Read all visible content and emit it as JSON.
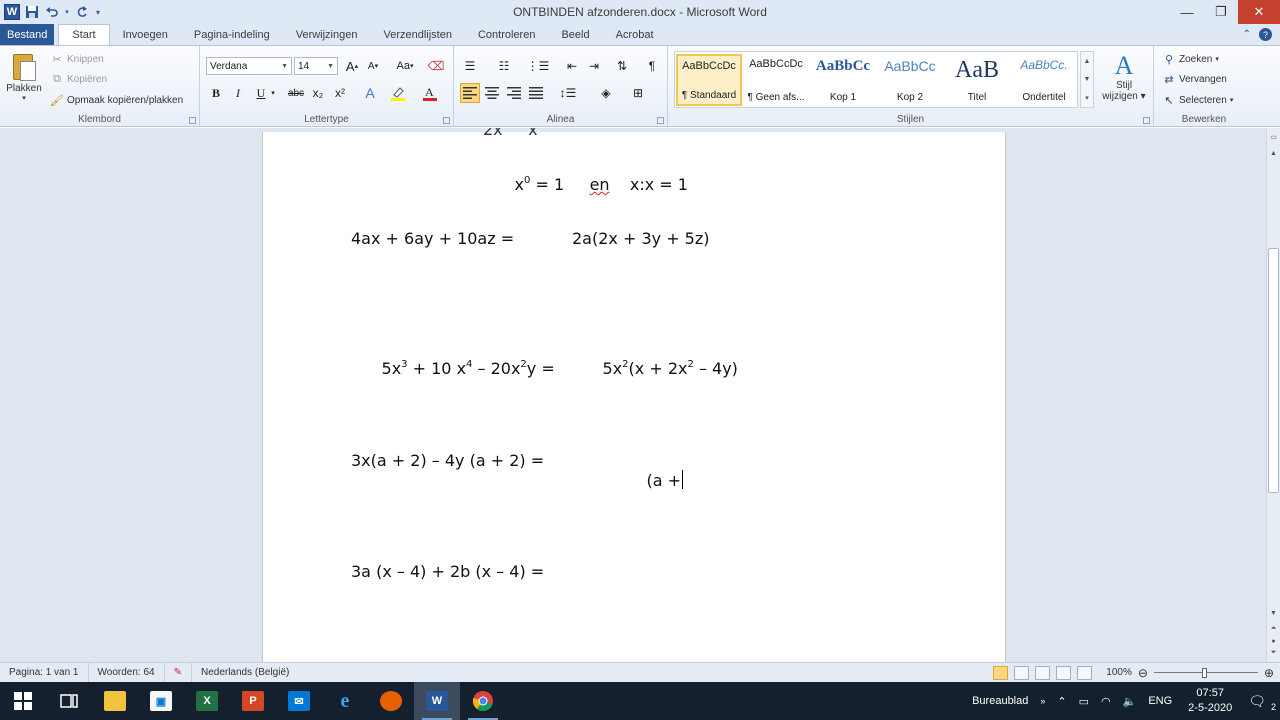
{
  "window": {
    "title": "ONTBINDEN afzonderen.docx - Microsoft Word",
    "app_logo": "W",
    "controls": [
      "minimize-icon",
      "restore-icon",
      "close-icon"
    ]
  },
  "qat": {
    "save": "save-icon",
    "undo": "undo-icon",
    "redo": "redo-icon"
  },
  "tabs": [
    "Bestand",
    "Start",
    "Invoegen",
    "Pagina-indeling",
    "Verwijzingen",
    "Verzendlijsten",
    "Controleren",
    "Beeld",
    "Acrobat"
  ],
  "active_tab": "Start",
  "ribbon": {
    "clipboard": {
      "label": "Klembord",
      "paste": "Plakken",
      "cut": "Knippen",
      "copy": "Kopiëren",
      "format_painter": "Opmaak kopiëren/plakken"
    },
    "font": {
      "label": "Lettertype",
      "font_name": "Verdana",
      "font_size": "14",
      "bold": "B",
      "italic": "I",
      "underline": "U",
      "strike": "abc",
      "subscript": "x₂",
      "superscript": "x²",
      "grow": "A",
      "shrink": "A",
      "case": "Aa"
    },
    "paragraph": {
      "label": "Alinea",
      "pilcrow": "¶"
    },
    "styles": {
      "label": "Stijlen",
      "items": [
        {
          "preview": "AaBbCcDc",
          "name": "¶ Standaard"
        },
        {
          "preview": "AaBbCcDc",
          "name": "¶ Geen afs..."
        },
        {
          "preview": "AaBbCc",
          "name": "Kop 1"
        },
        {
          "preview": "AaBbCc",
          "name": "Kop 2"
        },
        {
          "preview": "AaB",
          "name": "Titel"
        },
        {
          "preview": "AaBbCc.",
          "name": "Ondertitel"
        }
      ],
      "change_style_1": "Stijl",
      "change_style_2": "wijzigen"
    },
    "editing": {
      "label": "Bewerken",
      "find": "Zoeken",
      "replace": "Vervangen",
      "select": "Selecteren"
    }
  },
  "document": {
    "line0_a": "x",
    "line0_sup": "0",
    "line0_b": " = 1",
    "line0_en": "en",
    "line0_c": "x:x = 1",
    "eq1_left": "4ax + 6ay + 10az =",
    "eq1_right": "2a(2x + 3y + 5z)",
    "eq2_l1": "5x",
    "eq2_l1s": "3",
    "eq2_l2": " + 10 x",
    "eq2_l2s": "4",
    "eq2_l3": " – 20x",
    "eq2_l3s": "2",
    "eq2_l4": "y =",
    "eq2_r1": "5x",
    "eq2_r1s": "2",
    "eq2_r2": "(x + 2x",
    "eq2_r2s": "2",
    "eq2_r3": " – 4y)",
    "eq3_left": "3x(a + 2) – 4y (a + 2) =",
    "eq3_right": "(a +",
    "eq4_left": "3a (x – 4) + 2b (x – 4) ="
  },
  "statusbar": {
    "page": "Pagina: 1 van 1",
    "words": "Woorden: 64",
    "language": "Nederlands (België)",
    "zoom": "100%",
    "zoom_level_percent": 100
  },
  "taskbar": {
    "apps": [
      "start-icon",
      "task-view-icon",
      "file-explorer-icon",
      "store-icon",
      "excel-icon",
      "powerpoint-icon",
      "mail-icon",
      "internet-explorer-icon",
      "firefox-icon",
      "word-icon",
      "chrome-icon"
    ],
    "desktop_label": "Bureaublad",
    "lang": "ENG",
    "time": "07:57",
    "date": "2-5-2020",
    "notifications": "2"
  }
}
